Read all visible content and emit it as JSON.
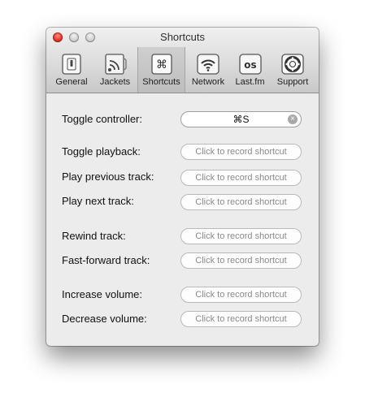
{
  "window": {
    "title": "Shortcuts"
  },
  "toolbar": {
    "tabs": [
      {
        "label": "General",
        "icon": "general-switch-icon"
      },
      {
        "label": "Jackets",
        "icon": "jackets-icon"
      },
      {
        "label": "Shortcuts",
        "icon": "command-key-icon",
        "selected": true
      },
      {
        "label": "Network",
        "icon": "wifi-icon"
      },
      {
        "label": "Last.fm",
        "icon": "lastfm-icon"
      },
      {
        "label": "Support",
        "icon": "lifebuoy-icon"
      }
    ]
  },
  "shortcuts": {
    "toggle_controller": {
      "label": "Toggle controller:",
      "value": "⌘S",
      "clear_glyph": "×"
    },
    "toggle_playback": {
      "label": "Toggle playback:",
      "placeholder": "Click to record shortcut"
    },
    "play_previous": {
      "label": "Play previous track:",
      "placeholder": "Click to record shortcut"
    },
    "play_next": {
      "label": "Play next track:",
      "placeholder": "Click to record shortcut"
    },
    "rewind": {
      "label": "Rewind track:",
      "placeholder": "Click to record shortcut"
    },
    "fast_forward": {
      "label": "Fast-forward track:",
      "placeholder": "Click to record shortcut"
    },
    "increase_volume": {
      "label": "Increase volume:",
      "placeholder": "Click to record shortcut"
    },
    "decrease_volume": {
      "label": "Decrease volume:",
      "placeholder": "Click to record shortcut"
    }
  },
  "colors": {
    "window_bg": "#ececec",
    "close_button": "#e5342a"
  }
}
